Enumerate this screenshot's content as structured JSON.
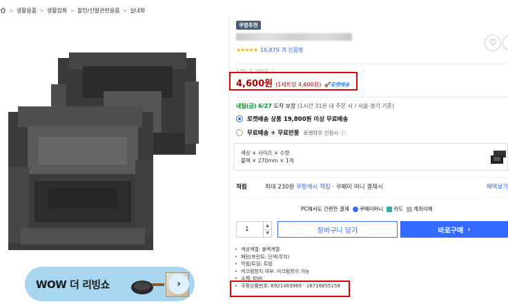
{
  "breadcrumb": {
    "items": [
      "생활용품",
      "생활잡화",
      "할인/신발관련용품",
      "실내화"
    ],
    "separator": ">"
  },
  "banner": {
    "text": "WOW 더 리빙쇼",
    "arrow": "›"
  },
  "product": {
    "badge": "쿠팡추천",
    "stars": "★★★★★",
    "review_count": "16,879 개 상품평"
  },
  "price": {
    "original": "13% 5,290원 ⓘ",
    "main": "4,600원",
    "unit": "(1세트당 4,600원)",
    "delivery_badge": "🚀로켓배송"
  },
  "arrival": {
    "date": "내일(금) 6/27",
    "guarantee": "도착 보장",
    "note": "(1시간 31분 내 주문 시 / 서울⋅경기 기준)"
  },
  "shipping": {
    "option1": "로켓배송 상품 19,800원 이상 무료배송",
    "option2_main": "무료배송 + 무료반품",
    "option2_sub": "로켓와우 신청시 ⓘ"
  },
  "options": {
    "line1": "색상 × 사이즈 × 수량",
    "line2": "블랙 × 270mm × 1개"
  },
  "benefit": {
    "label": "적립",
    "text_prefix": "최대 230원",
    "cash": "쿠팡캐시 적립",
    "text_suffix": "· 쿠페이 머니 결제시",
    "more": "혜택보기"
  },
  "pc_pay": {
    "label": "PC에서도 간편한 결제",
    "coupay": "쿠페이머니",
    "card": "카드",
    "bank": "계좌이체"
  },
  "purchase": {
    "quantity": "1",
    "up": "▲",
    "down": "▼",
    "cart_label": "장바구니 담기",
    "buy_label": "바로구매",
    "buy_arrow": "›"
  },
  "specs": [
    "색상계열: 블랙계열",
    "패턴/프린트: 단색(무지)",
    "막힘/트임: 트임",
    "미끄럼방지 여부: 미끄럼방지 가능",
    "소재: EVA",
    "쿠팡상품번호: 6921483969 - 16716655159"
  ],
  "colors": {
    "accent": "#346aff",
    "price": "#ae0000",
    "highlight_box": "#e30000",
    "arrival": "#00891a"
  },
  "icons": [
    "home-icon",
    "heart-icon",
    "share-icon",
    "rocket-icon",
    "info-icon"
  ]
}
